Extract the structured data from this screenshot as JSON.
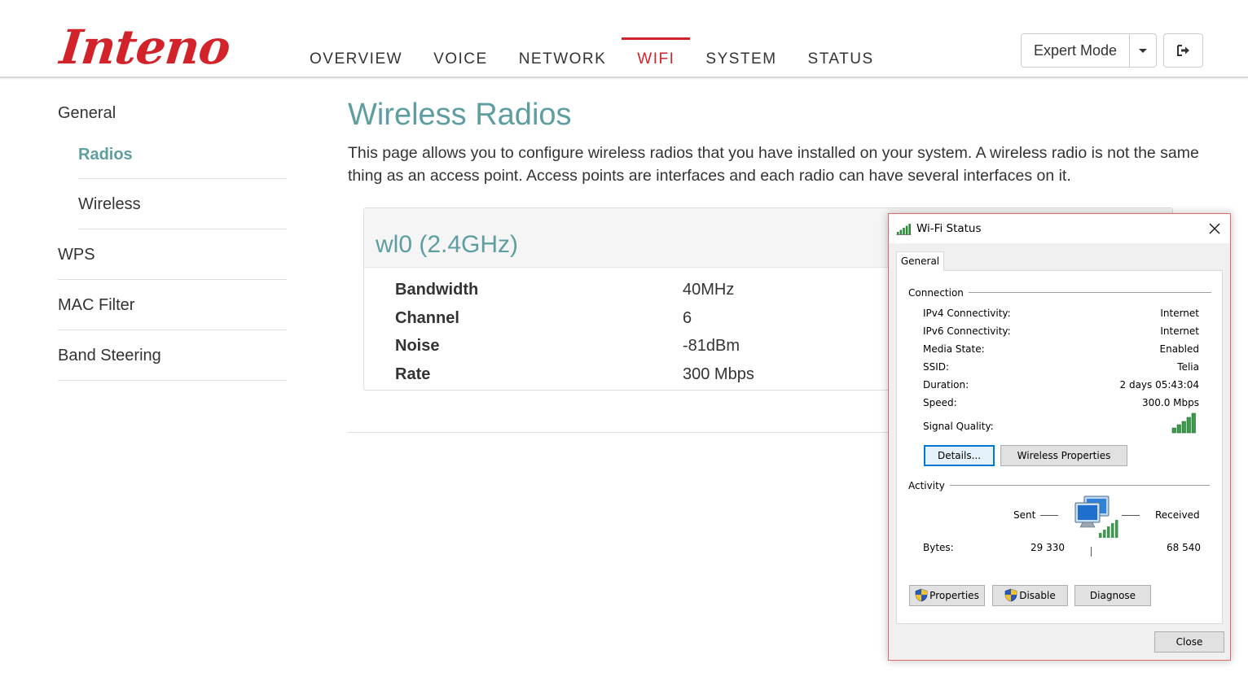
{
  "brand": {
    "logo_text": "Inteno",
    "accent_color": "#d3232a",
    "title_color": "#5e9ea0"
  },
  "nav": {
    "items": [
      {
        "label": "OVERVIEW",
        "active": false
      },
      {
        "label": "VOICE",
        "active": false
      },
      {
        "label": "NETWORK",
        "active": false
      },
      {
        "label": "WIFI",
        "active": true
      },
      {
        "label": "SYSTEM",
        "active": false
      },
      {
        "label": "STATUS",
        "active": false
      }
    ],
    "mode_label": "Expert Mode",
    "mode_caret_icon": "chevron-down-icon",
    "logout_icon": "logout-icon"
  },
  "sidebar": {
    "items": [
      {
        "label": "General"
      },
      {
        "label": "Radios",
        "sub": true,
        "active": true
      },
      {
        "label": "Wireless",
        "sub": true
      },
      {
        "label": "WPS"
      },
      {
        "label": "MAC Filter"
      },
      {
        "label": "Band Steering"
      }
    ]
  },
  "main": {
    "title": "Wireless Radios",
    "description": "This page allows you to configure wireless radios that you have installed on your system. A wireless radio is not the same thing as an access point. Access points are interfaces and each radio can have several interfaces on it.",
    "radio": {
      "name": "wl0 (2.4GHz)",
      "rows": [
        {
          "key": "Bandwidth",
          "value": "40MHz"
        },
        {
          "key": "Channel",
          "value": "6"
        },
        {
          "key": "Noise",
          "value": "-81dBm"
        },
        {
          "key": "Rate",
          "value": "300 Mbps"
        }
      ]
    }
  },
  "dialog": {
    "title": "Wi-Fi Status",
    "title_icon": "wifi-signal-icon",
    "close_icon": "close-icon",
    "tab": "General",
    "connection": {
      "label": "Connection",
      "rows": [
        {
          "label": "IPv4 Connectivity:",
          "value": "Internet"
        },
        {
          "label": "IPv6 Connectivity:",
          "value": "Internet"
        },
        {
          "label": "Media State:",
          "value": "Enabled"
        },
        {
          "label": "SSID:",
          "value": "Telia"
        },
        {
          "label": "Duration:",
          "value": "2 days 05:43:04"
        },
        {
          "label": "Speed:",
          "value": "300.0 Mbps"
        }
      ],
      "signal_label": "Signal Quality:",
      "signal_bars": 5
    },
    "buttons": {
      "details": "Details...",
      "wireless_properties": "Wireless Properties"
    },
    "activity": {
      "label": "Activity",
      "sent_label": "Sent",
      "received_label": "Received",
      "bytes_label": "Bytes:",
      "bytes_sent": "29 330",
      "bytes_received": "68 540"
    },
    "bottom_buttons": {
      "properties": "Properties",
      "disable": "Disable",
      "diagnose": "Diagnose"
    },
    "close_button": "Close"
  }
}
